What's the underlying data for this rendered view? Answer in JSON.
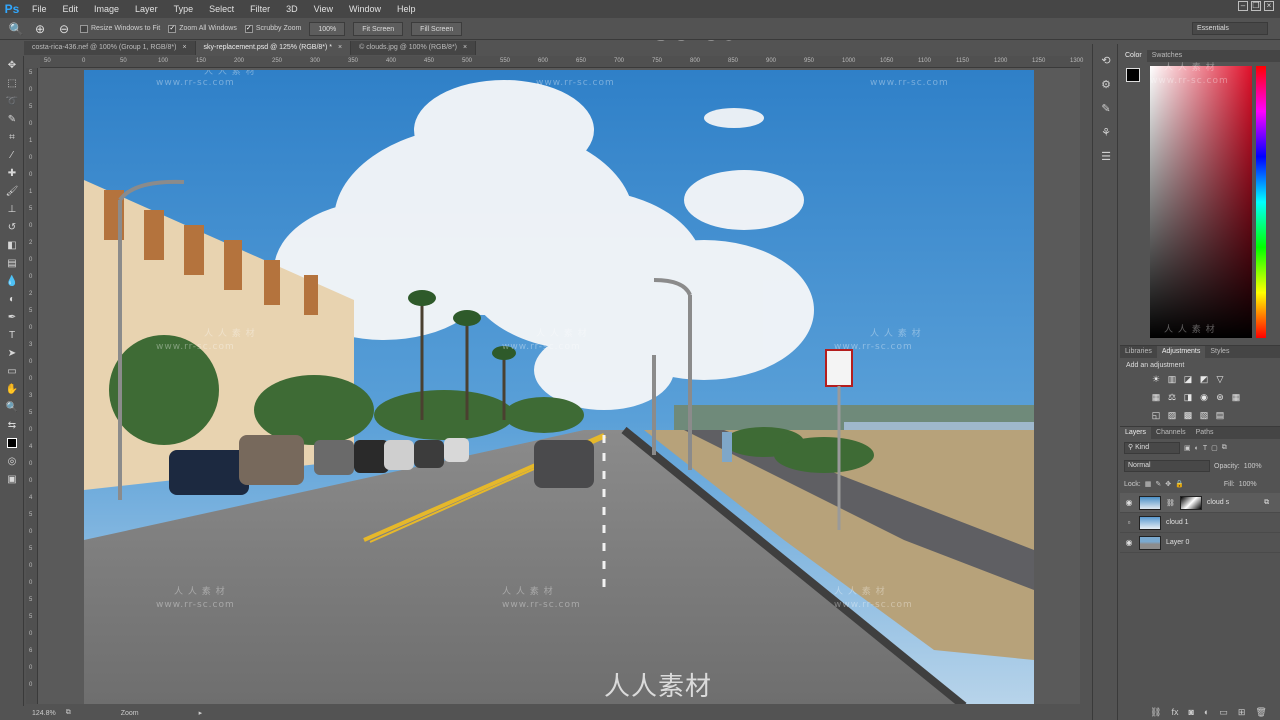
{
  "app": {
    "logo": "Ps"
  },
  "menu": [
    "File",
    "Edit",
    "Image",
    "Layer",
    "Type",
    "Select",
    "Filter",
    "3D",
    "View",
    "Window",
    "Help"
  ],
  "watermark": {
    "top": "www.rr-sc.com",
    "bottom": "人人素材",
    "site": "www.rr-sc.com",
    "cn": "人 人 素 材"
  },
  "options": {
    "resize_windows": "Resize Windows to Fit",
    "zoom_all": "Zoom All Windows",
    "scrubby": "Scrubby Zoom",
    "zoom_value": "100%",
    "fit_screen": "Fit Screen",
    "fill_screen": "Fill Screen",
    "workspace": "Essentials"
  },
  "tabs": [
    {
      "label": "costa-rica-436.nef @ 100% (Group 1, RGB/8*)",
      "close": "×"
    },
    {
      "label": "sky-replacement.psd @ 125% (RGB/8*) *",
      "close": "×"
    },
    {
      "label": "© clouds.jpg @ 100% (RGB/8*)",
      "close": "×"
    }
  ],
  "ruler_top": [
    "50",
    "0",
    "50",
    "100",
    "150",
    "200",
    "250",
    "300",
    "350",
    "400",
    "450",
    "500",
    "550",
    "600",
    "650",
    "700",
    "750",
    "800",
    "850",
    "900",
    "950",
    "1000",
    "1050",
    "1100",
    "1150",
    "1200",
    "1250",
    "1300"
  ],
  "ruler_left": [
    "5",
    "0",
    "5",
    "0",
    "1",
    "0",
    "0",
    "1",
    "5",
    "0",
    "2",
    "0",
    "0",
    "2",
    "5",
    "0",
    "3",
    "0",
    "0",
    "3",
    "5",
    "0",
    "4",
    "0",
    "0",
    "4",
    "5",
    "0",
    "5",
    "0",
    "0",
    "5",
    "5",
    "0",
    "6",
    "0",
    "0"
  ],
  "status": {
    "zoom": "124.8%",
    "tool": "Zoom"
  },
  "panels": {
    "color_tabs": [
      "Color",
      "Swatches"
    ],
    "adj_tabs": [
      "Libraries",
      "Adjustments",
      "Styles"
    ],
    "adj_title": "Add an adjustment",
    "layer_tabs": [
      "Layers",
      "Channels",
      "Paths"
    ],
    "kind": "Kind",
    "blend_mode": "Normal",
    "opacity_label": "Opacity:",
    "opacity": "100%",
    "lock_label": "Lock:",
    "fill_label": "Fill:",
    "fill": "100%"
  },
  "layers": [
    {
      "name": "cloud s",
      "visible": true
    },
    {
      "name": "cloud 1",
      "visible": false
    },
    {
      "name": "Layer 0",
      "visible": true
    }
  ],
  "colors": {
    "accent": "#31a8ff",
    "sky": "#4a95cc"
  }
}
